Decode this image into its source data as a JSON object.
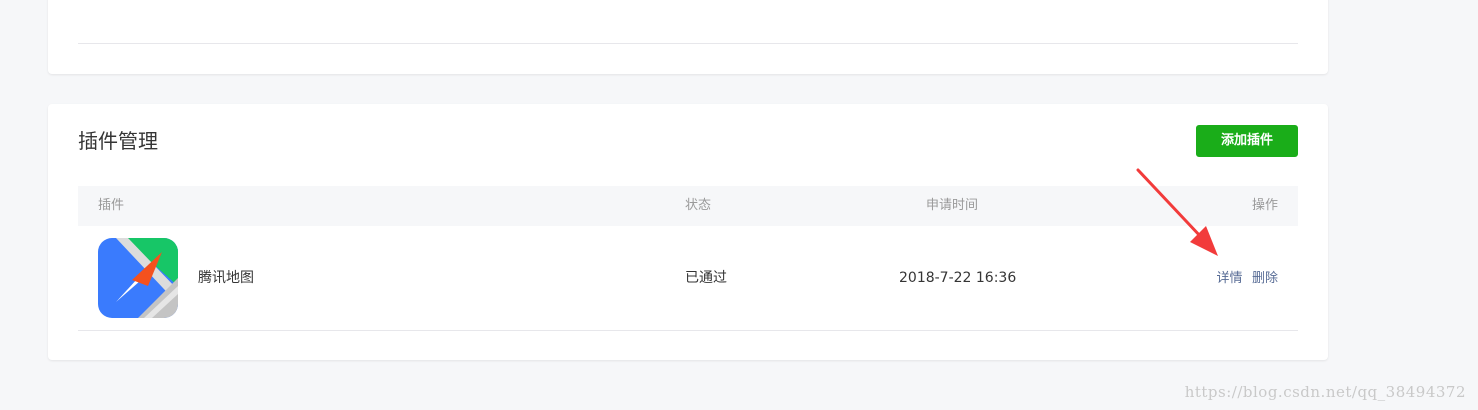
{
  "plugin_panel": {
    "title": "插件管理",
    "add_button_label": "添加插件",
    "columns": {
      "plugin": "插件",
      "status": "状态",
      "apply_time": "申请时间",
      "actions": "操作"
    },
    "rows": [
      {
        "icon": "tencent-map-logo",
        "name": "腾讯地图",
        "status": "已通过",
        "apply_time": "2018-7-22 16:36",
        "detail_label": "详情",
        "delete_label": "删除"
      }
    ]
  },
  "watermark": "https://blog.csdn.net/qq_38494372",
  "colors": {
    "primary_button": "#1aad19",
    "link": "#576b95",
    "annotation_arrow": "#f23b3b",
    "page_bg": "#f6f7f9"
  }
}
